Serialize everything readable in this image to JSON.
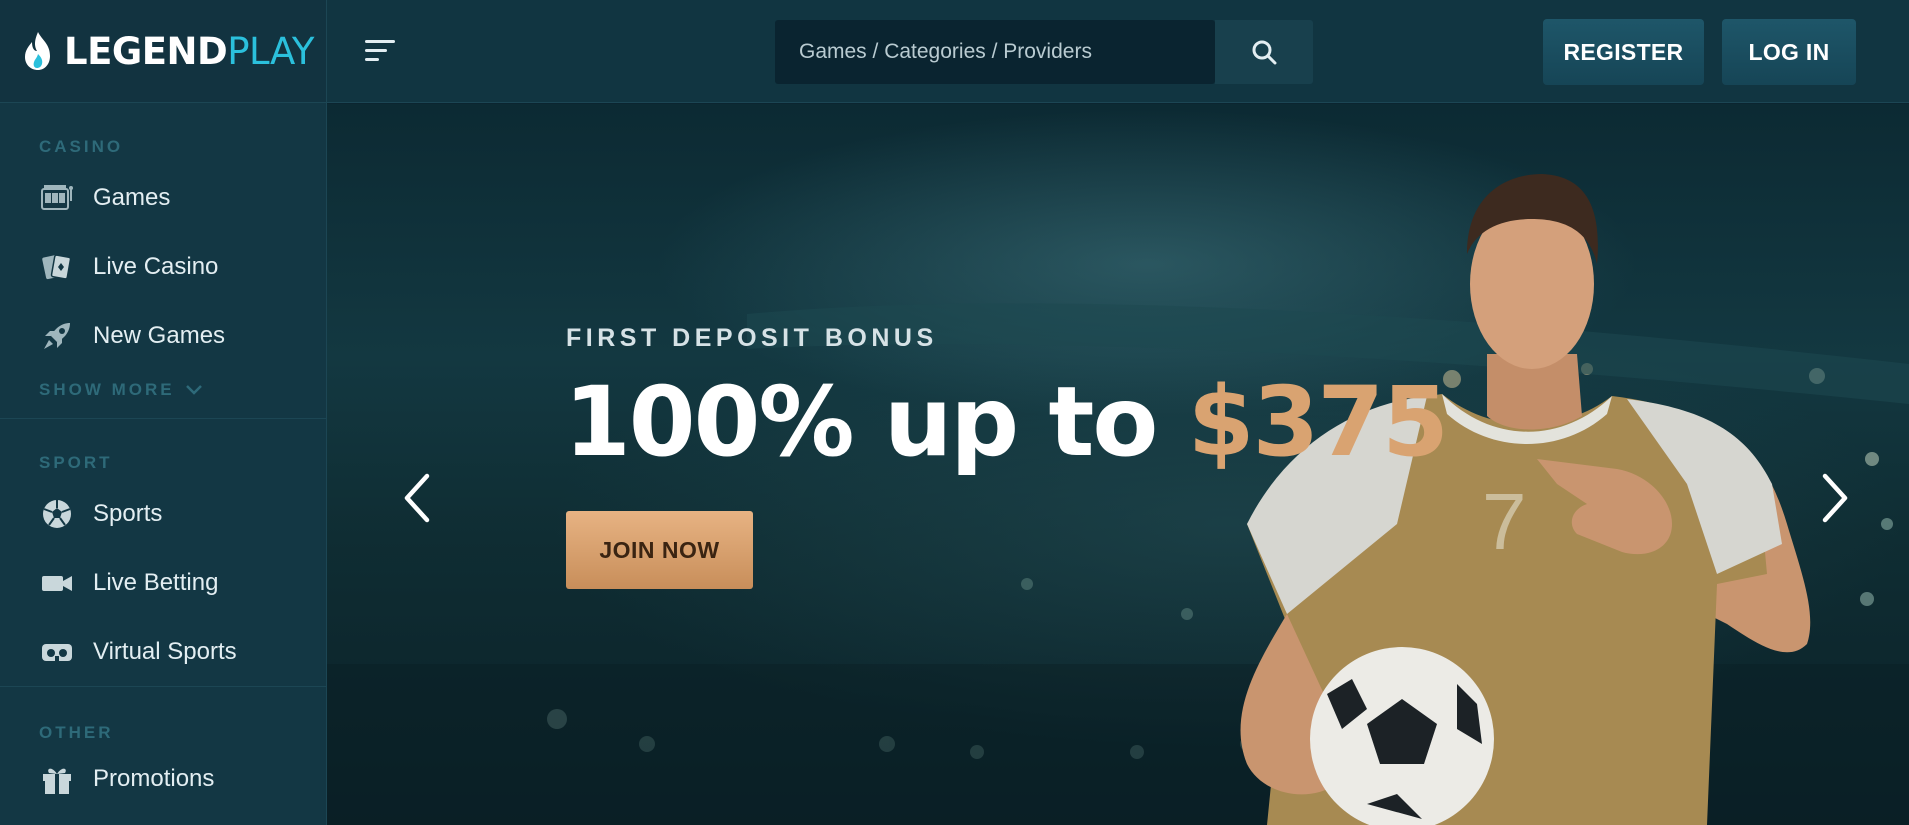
{
  "brand": {
    "logo_part1": "LEGEND",
    "logo_part2": "PLAY"
  },
  "header": {
    "search_placeholder": "Games / Categories / Providers",
    "register_label": "REGISTER",
    "login_label": "LOG IN"
  },
  "sidebar": {
    "casino_label": "CASINO",
    "casino_items": [
      {
        "label": "Games",
        "icon": "slot-machine-icon"
      },
      {
        "label": "Live Casino",
        "icon": "playing-cards-icon"
      },
      {
        "label": "New Games",
        "icon": "rocket-icon"
      }
    ],
    "show_more_label": "SHOW MORE",
    "sport_label": "SPORT",
    "sport_items": [
      {
        "label": "Sports",
        "icon": "soccer-ball-icon"
      },
      {
        "label": "Live Betting",
        "icon": "video-camera-icon"
      },
      {
        "label": "Virtual Sports",
        "icon": "vr-headset-icon"
      }
    ],
    "other_label": "OTHER",
    "other_items": [
      {
        "label": "Promotions",
        "icon": "gift-icon"
      }
    ]
  },
  "hero": {
    "eyebrow": "FIRST DEPOSIT BONUS",
    "headline_prefix": "100% up to ",
    "headline_amount": "$375",
    "cta_label": "JOIN NOW",
    "jersey_number": "7"
  },
  "colors": {
    "accent": "#2bc0dc",
    "gold": "#d9a371",
    "sidebar_bg": "#133744",
    "header_bg": "#113541"
  }
}
